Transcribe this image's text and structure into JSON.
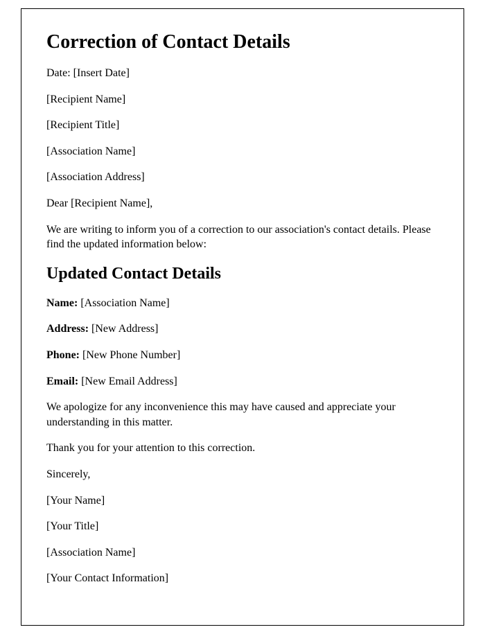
{
  "title": "Correction of Contact Details",
  "date_label": "Date: ",
  "date_value": "[Insert Date]",
  "recipient_name": "[Recipient Name]",
  "recipient_title": "[Recipient Title]",
  "association_name": "[Association Name]",
  "association_address": "[Association Address]",
  "salutation_prefix": "Dear ",
  "salutation_name": "[Recipient Name]",
  "salutation_suffix": ",",
  "intro": "We are writing to inform you of a correction to our association's contact details. Please find the updated information below:",
  "subheading": "Updated Contact Details",
  "details": {
    "name_label": "Name: ",
    "name_value": "[Association Name]",
    "address_label": "Address: ",
    "address_value": "[New Address]",
    "phone_label": "Phone: ",
    "phone_value": "[New Phone Number]",
    "email_label": "Email: ",
    "email_value": "[New Email Address]"
  },
  "apology": "We apologize for any inconvenience this may have caused and appreciate your understanding in this matter.",
  "thanks": "Thank you for your attention to this correction.",
  "closing": "Sincerely,",
  "sender": {
    "name": "[Your Name]",
    "title": "[Your Title]",
    "association": "[Association Name]",
    "contact": "[Your Contact Information]"
  }
}
